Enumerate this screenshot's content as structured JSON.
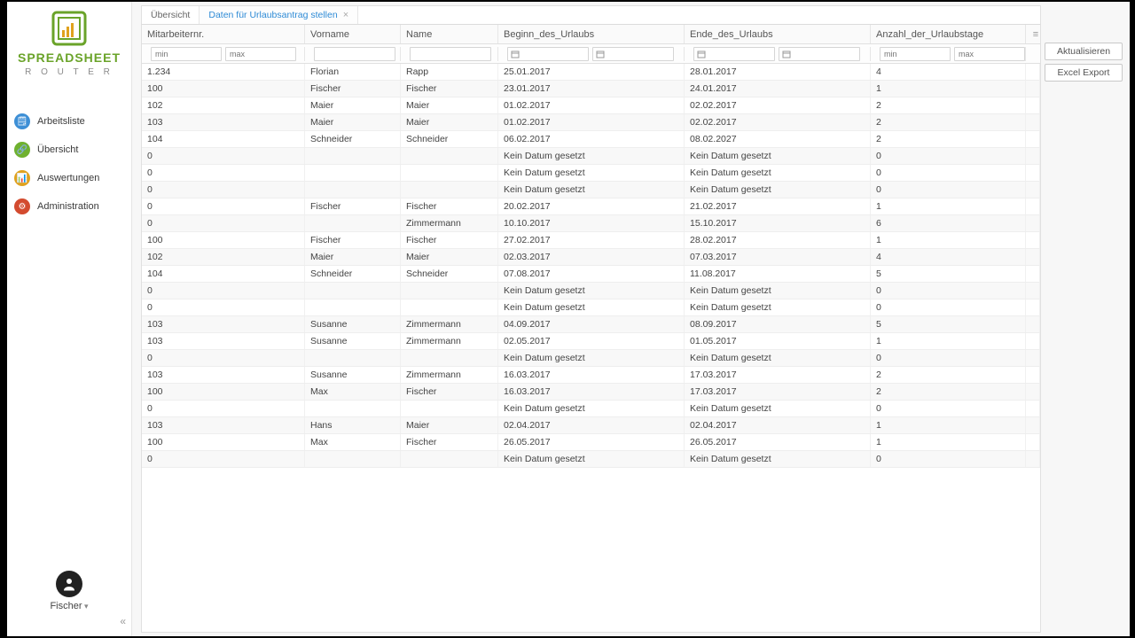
{
  "brand": {
    "line1": "SPREADSHEET",
    "line2": "R O U T E R"
  },
  "nav": [
    {
      "label": "Arbeitsliste",
      "color": "#3d8fd6",
      "glyph": "🗒"
    },
    {
      "label": "Übersicht",
      "color": "#6fb12f",
      "glyph": "🔗"
    },
    {
      "label": "Auswertungen",
      "color": "#e0a21e",
      "glyph": "📊"
    },
    {
      "label": "Administration",
      "color": "#d34b2f",
      "glyph": "⚙"
    }
  ],
  "user": {
    "name": "Fischer"
  },
  "tabs": [
    {
      "label": "Übersicht",
      "active": false,
      "closable": false
    },
    {
      "label": "Daten für Urlaubsantrag stellen",
      "active": true,
      "closable": true
    }
  ],
  "actions": {
    "refresh": "Aktualisieren",
    "export": "Excel Export"
  },
  "columns": [
    {
      "key": "nr",
      "label": "Mitarbeiternr.",
      "type": "num"
    },
    {
      "key": "vor",
      "label": "Vorname",
      "type": "txt"
    },
    {
      "key": "name",
      "label": "Name",
      "type": "txt"
    },
    {
      "key": "begin",
      "label": "Beginn_des_Urlaubs",
      "type": "date"
    },
    {
      "key": "end",
      "label": "Ende_des_Urlaubs",
      "type": "date"
    },
    {
      "key": "days",
      "label": "Anzahl_der_Urlaubstage",
      "type": "num"
    }
  ],
  "filter_placeholders": {
    "min": "min",
    "max": "max"
  },
  "rows": [
    {
      "nr": "1.234",
      "vor": "Florian",
      "name": "Rapp",
      "begin": "25.01.2017",
      "end": "28.01.2017",
      "days": "4"
    },
    {
      "nr": "100",
      "vor": "Fischer",
      "name": "Fischer",
      "begin": "23.01.2017",
      "end": "24.01.2017",
      "days": "1"
    },
    {
      "nr": "102",
      "vor": "Maier",
      "name": "Maier",
      "begin": "01.02.2017",
      "end": "02.02.2017",
      "days": "2"
    },
    {
      "nr": "103",
      "vor": "Maier",
      "name": "Maier",
      "begin": "01.02.2017",
      "end": "02.02.2017",
      "days": "2"
    },
    {
      "nr": "104",
      "vor": "Schneider",
      "name": "Schneider",
      "begin": "06.02.2017",
      "end": "08.02.2027",
      "days": "2"
    },
    {
      "nr": "0",
      "vor": "",
      "name": "",
      "begin": "Kein Datum gesetzt",
      "end": "Kein Datum gesetzt",
      "days": "0"
    },
    {
      "nr": "0",
      "vor": "",
      "name": "",
      "begin": "Kein Datum gesetzt",
      "end": "Kein Datum gesetzt",
      "days": "0"
    },
    {
      "nr": "0",
      "vor": "",
      "name": "",
      "begin": "Kein Datum gesetzt",
      "end": "Kein Datum gesetzt",
      "days": "0"
    },
    {
      "nr": "0",
      "vor": "Fischer",
      "name": "Fischer",
      "begin": "20.02.2017",
      "end": "21.02.2017",
      "days": "1"
    },
    {
      "nr": "0",
      "vor": "",
      "name": "Zimmermann",
      "begin": "10.10.2017",
      "end": "15.10.2017",
      "days": "6"
    },
    {
      "nr": "100",
      "vor": "Fischer",
      "name": "Fischer",
      "begin": "27.02.2017",
      "end": "28.02.2017",
      "days": "1"
    },
    {
      "nr": "102",
      "vor": "Maier",
      "name": "Maier",
      "begin": "02.03.2017",
      "end": "07.03.2017",
      "days": "4"
    },
    {
      "nr": "104",
      "vor": "Schneider",
      "name": "Schneider",
      "begin": "07.08.2017",
      "end": "11.08.2017",
      "days": "5"
    },
    {
      "nr": "0",
      "vor": "",
      "name": "",
      "begin": "Kein Datum gesetzt",
      "end": "Kein Datum gesetzt",
      "days": "0"
    },
    {
      "nr": "0",
      "vor": "",
      "name": "",
      "begin": "Kein Datum gesetzt",
      "end": "Kein Datum gesetzt",
      "days": "0"
    },
    {
      "nr": "103",
      "vor": "Susanne",
      "name": "Zimmermann",
      "begin": "04.09.2017",
      "end": "08.09.2017",
      "days": "5"
    },
    {
      "nr": "103",
      "vor": "Susanne",
      "name": "Zimmermann",
      "begin": "02.05.2017",
      "end": "01.05.2017",
      "days": "1"
    },
    {
      "nr": "0",
      "vor": "",
      "name": "",
      "begin": "Kein Datum gesetzt",
      "end": "Kein Datum gesetzt",
      "days": "0"
    },
    {
      "nr": "103",
      "vor": "Susanne",
      "name": "Zimmermann",
      "begin": "16.03.2017",
      "end": "17.03.2017",
      "days": "2"
    },
    {
      "nr": "100",
      "vor": "Max",
      "name": "Fischer",
      "begin": "16.03.2017",
      "end": "17.03.2017",
      "days": "2"
    },
    {
      "nr": "0",
      "vor": "",
      "name": "",
      "begin": "Kein Datum gesetzt",
      "end": "Kein Datum gesetzt",
      "days": "0"
    },
    {
      "nr": "103",
      "vor": "Hans",
      "name": "Maier",
      "begin": "02.04.2017",
      "end": "02.04.2017",
      "days": "1"
    },
    {
      "nr": "100",
      "vor": "Max",
      "name": "Fischer",
      "begin": "26.05.2017",
      "end": "26.05.2017",
      "days": "1"
    },
    {
      "nr": "0",
      "vor": "",
      "name": "",
      "begin": "Kein Datum gesetzt",
      "end": "Kein Datum gesetzt",
      "days": "0"
    }
  ]
}
